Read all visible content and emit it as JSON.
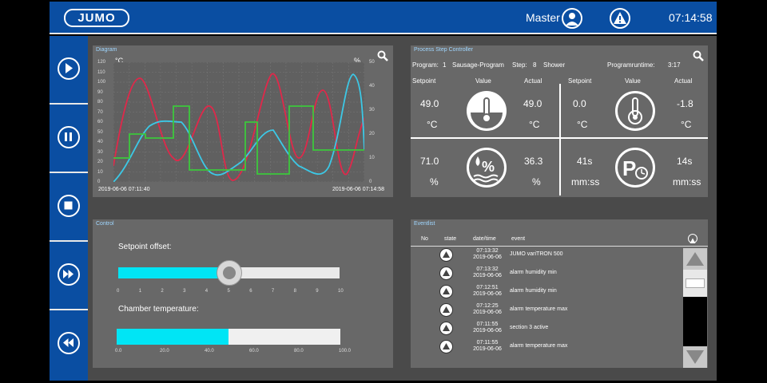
{
  "header": {
    "logo": "JUMO",
    "user": "Master",
    "time": "07:14:58",
    "user_icon": "user-icon",
    "warning_icon": "warning-icon"
  },
  "sidebar": {
    "buttons": [
      {
        "name": "play",
        "icon": "play-icon"
      },
      {
        "name": "pause",
        "icon": "pause-icon"
      },
      {
        "name": "stop",
        "icon": "stop-icon"
      },
      {
        "name": "fast-forward",
        "icon": "fast-forward-icon"
      },
      {
        "name": "rewind",
        "icon": "rewind-icon"
      }
    ]
  },
  "diagram": {
    "title": "Diagram",
    "left_unit": "°C",
    "right_unit": "%",
    "left_ticks": [
      "120",
      "110",
      "100",
      "90",
      "80",
      "70",
      "60",
      "50",
      "40",
      "30",
      "20",
      "10",
      "0"
    ],
    "right_ticks": [
      "50",
      "40",
      "30",
      "20",
      "10",
      "0"
    ],
    "time_start": "2019-06-06 07:11:40",
    "time_end": "2019-06-06 07:14:58",
    "colors": {
      "red": "#e0284a",
      "cyan": "#3cc8e6",
      "green": "#3cc83c"
    }
  },
  "process": {
    "title": "Process Step Controller",
    "program_label": "Program:",
    "program_num": "1",
    "program_name": "Sausage-Program",
    "step_label": "Step:",
    "step_num": "8",
    "step_name": "Shower",
    "runtime_label": "Programruntime:",
    "runtime": "3:17",
    "headers": {
      "setpoint": "Setpoint",
      "value": "Value",
      "actual": "Actual"
    },
    "cells": [
      {
        "setpoint": "49.0",
        "unit_left": "°C",
        "actual": "49.0",
        "unit_right": "°C",
        "icon": "thermometer-icon"
      },
      {
        "setpoint": "0.0",
        "unit_left": "°C",
        "actual": "-1.8",
        "unit_right": "°C",
        "icon": "core-probe-icon"
      },
      {
        "setpoint": "71.0",
        "unit_left": "%",
        "actual": "36.3",
        "unit_right": "%",
        "icon": "humidity-icon"
      },
      {
        "setpoint": "41s",
        "unit_left": "mm:ss",
        "actual": "14s",
        "unit_right": "mm:ss",
        "icon": "pause-timer-icon"
      }
    ]
  },
  "control": {
    "title": "Control",
    "setpoint_label": "Setpoint offset:",
    "slider_value": 5,
    "slider_ticks": [
      "0",
      "1",
      "2",
      "3",
      "4",
      "5",
      "6",
      "7",
      "8",
      "9",
      "10"
    ],
    "chamber_label": "Chamber temperature:",
    "chamber_value": 50,
    "chamber_ticks": [
      "0.0",
      "20.0",
      "40.0",
      "60.0",
      "80.0",
      "100.0"
    ],
    "fill_color": "#00e5f5"
  },
  "eventlist": {
    "title": "Eventlist",
    "headers": {
      "no": "No",
      "state": "state",
      "datetime": "date/time",
      "event": "event"
    },
    "rows": [
      {
        "time": "07:13:32",
        "date": "2019-06-06",
        "event": "JUMO variTRON 500",
        "icon": "warning-icon"
      },
      {
        "time": "07:13:32",
        "date": "2019-06-06",
        "event": "alarm humidity min",
        "icon": "alarm-icon"
      },
      {
        "time": "07:12:51",
        "date": "2019-06-06",
        "event": "alarm humidity min",
        "icon": "alarm-icon"
      },
      {
        "time": "07:12:25",
        "date": "2019-06-06",
        "event": "alarm temperature max",
        "icon": "alarm-icon"
      },
      {
        "time": "07:11:55",
        "date": "2019-06-06",
        "event": "section 3 active",
        "icon": "warning-icon"
      },
      {
        "time": "07:11:55",
        "date": "2019-06-06",
        "event": "alarm temperature max",
        "icon": "alarm-icon"
      }
    ]
  }
}
